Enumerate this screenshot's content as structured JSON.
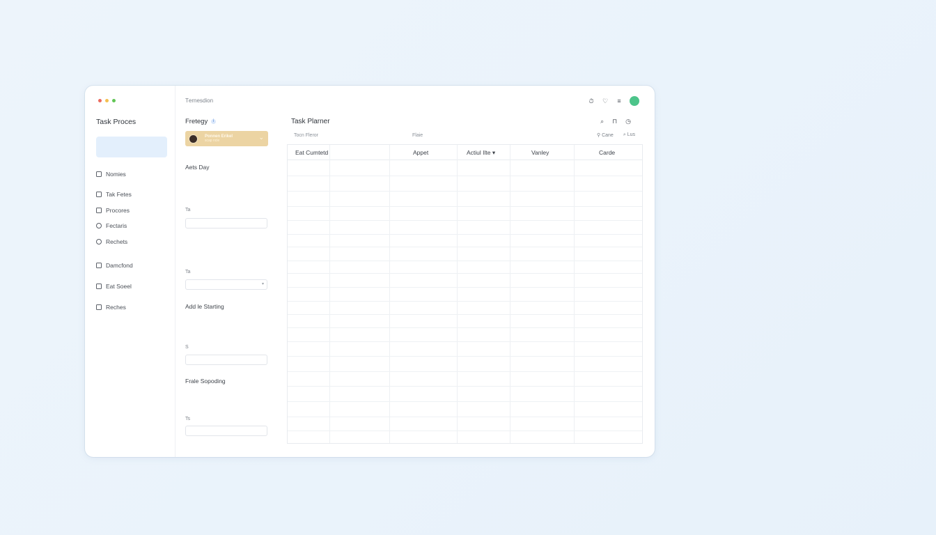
{
  "window": {
    "title": "Тernesdion"
  },
  "traffic_lights": [
    "#ec6a5e",
    "#f4bf4f",
    "#61c554"
  ],
  "sidebar": {
    "app_title": "Task Proces",
    "items": [
      {
        "label": "Nomies",
        "icon": "book-icon"
      },
      {
        "label": "Tak Fetes",
        "icon": "square-icon"
      },
      {
        "label": "Procores",
        "icon": "square-icon"
      },
      {
        "label": "Fectaris",
        "icon": "circle-icon"
      },
      {
        "label": "Rechets",
        "icon": "circle-icon"
      },
      {
        "label": "Damcfond",
        "icon": "lock-icon"
      },
      {
        "label": "Eat Soeel",
        "icon": "square-icon"
      },
      {
        "label": "Reches",
        "icon": "clock-icon"
      }
    ]
  },
  "filters": {
    "title": "Fretegy",
    "info_icon": "i",
    "profile": {
      "name": "Ponnen Erikel",
      "sub": "scap ncle"
    },
    "sections": [
      {
        "label": "Aets Day",
        "field_label": "Ta"
      },
      {
        "label": "",
        "field_label": "Ta"
      },
      {
        "label": "Add le Starting",
        "field_label": "S"
      },
      {
        "label": "Frale Sopoding",
        "field_label": "Ts"
      }
    ]
  },
  "main": {
    "title": "Task Plarner",
    "sub_left": "Tocn Fleror",
    "sub_mid": "Flaie",
    "sub_right": [
      "Cane",
      "Lus"
    ],
    "columns": [
      "Eat Cumtetd",
      "Appet",
      "Actiul Ilte",
      "Vanley",
      "Carde"
    ],
    "sort_indicator": "▾"
  },
  "colors": {
    "accent": "#4cc48a",
    "profile_card": "#ecd4a3",
    "sidebar_highlight": "#e3effc"
  }
}
